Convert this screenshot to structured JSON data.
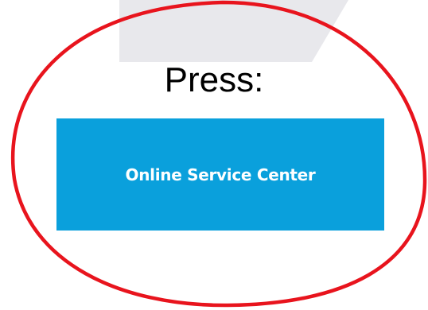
{
  "prompt": {
    "label": "Press:"
  },
  "button": {
    "label": "Online Service Center"
  },
  "colors": {
    "highlight_ring": "#e8141d",
    "button_background": "#0aa0dc",
    "button_text": "#ffffff",
    "backdrop_shape": "#e8e8ec",
    "page_background": "#ffffff"
  }
}
